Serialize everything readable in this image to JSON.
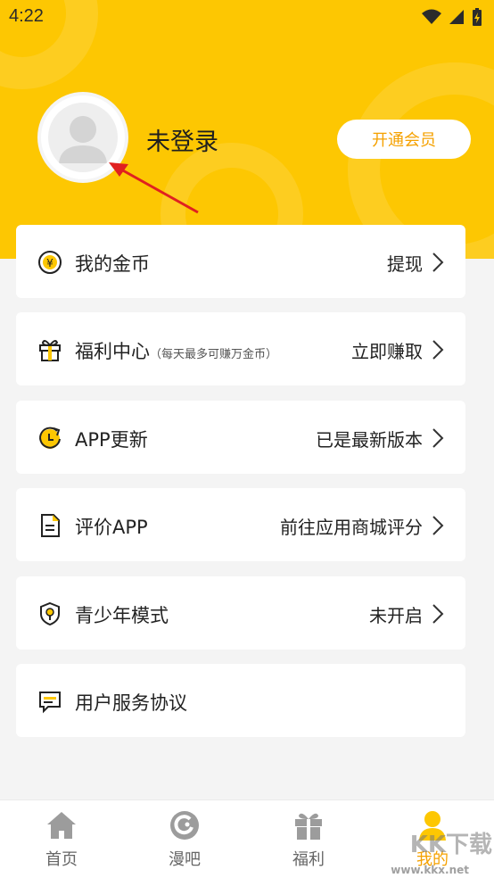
{
  "status_bar": {
    "time": "4:22"
  },
  "profile": {
    "login_status": "未登录",
    "vip_button": "开通会员"
  },
  "menu": [
    {
      "name": "coins",
      "icon": "coin-icon",
      "label": "我的金币",
      "sub": "",
      "value": "提现"
    },
    {
      "name": "welfare",
      "icon": "gift-icon",
      "label": "福利中心",
      "sub": "（每天最多可赚万金币）",
      "value": "立即赚取"
    },
    {
      "name": "update",
      "icon": "update-icon",
      "label": "APP更新",
      "sub": "",
      "value": "已是最新版本"
    },
    {
      "name": "rate",
      "icon": "document-icon",
      "label": "评价APP",
      "sub": "",
      "value": "前往应用商城评分"
    },
    {
      "name": "teen-mode",
      "icon": "shield-icon",
      "label": "青少年模式",
      "sub": "",
      "value": "未开启"
    },
    {
      "name": "agreement",
      "icon": "message-icon",
      "label": "用户服务协议",
      "sub": "",
      "value": ""
    }
  ],
  "tabs": [
    {
      "name": "home",
      "icon": "home-icon",
      "label": "首页"
    },
    {
      "name": "manba",
      "icon": "manba-icon",
      "label": "漫吧"
    },
    {
      "name": "welfare",
      "icon": "gift-icon",
      "label": "福利"
    },
    {
      "name": "mine",
      "icon": "user-icon",
      "label": "我的"
    }
  ],
  "watermark": {
    "text": "KK下载",
    "url": "www.kkx.net"
  },
  "colors": {
    "accent": "#fdc702",
    "vip_text": "#f5a100",
    "background": "#f4f4f4"
  }
}
